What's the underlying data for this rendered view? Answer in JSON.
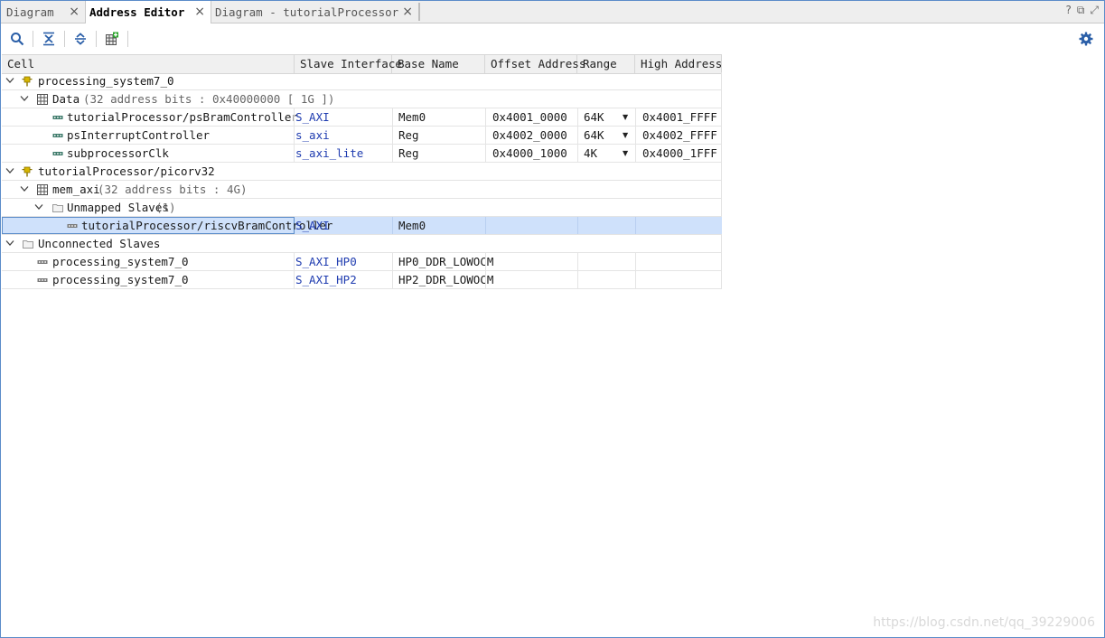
{
  "tabs": [
    {
      "label": "Diagram",
      "close": "×"
    },
    {
      "label": "Address Editor",
      "close": "×"
    },
    {
      "label": "Diagram - tutorialProcessor",
      "close": "×"
    }
  ],
  "window_controls": {
    "help": "?",
    "restore": "⧉",
    "maximize": "⤢"
  },
  "toolbar": {
    "search": "search-icon",
    "collapse_all": "collapse-all-icon",
    "expand_all": "expand-all-icon",
    "auto_assign": "auto-assign-address-icon",
    "settings": "gear-icon"
  },
  "columns": [
    "Cell",
    "Slave Interface",
    "Base Name",
    "Offset Address",
    "Range",
    "High Address"
  ],
  "rows": [
    {
      "cell": "processing_system7_0",
      "note": "",
      "slave": "",
      "base": "",
      "offset": "",
      "range": "",
      "high": ""
    },
    {
      "cell": "Data",
      "note": "(32 address bits : 0x40000000 [ 1G ])",
      "slave": "",
      "base": "",
      "offset": "",
      "range": "",
      "high": ""
    },
    {
      "cell": "tutorialProcessor/psBramController",
      "note": "",
      "slave": "S_AXI",
      "base": "Mem0",
      "offset": "0x4001_0000",
      "range": "64K",
      "high": "0x4001_FFFF"
    },
    {
      "cell": "psInterruptController",
      "note": "",
      "slave": "s_axi",
      "base": "Reg",
      "offset": "0x4002_0000",
      "range": "64K",
      "high": "0x4002_FFFF"
    },
    {
      "cell": "subprocessorClk",
      "note": "",
      "slave": "s_axi_lite",
      "base": "Reg",
      "offset": "0x4000_1000",
      "range": "4K",
      "high": "0x4000_1FFF"
    },
    {
      "cell": "tutorialProcessor/picorv32",
      "note": "",
      "slave": "",
      "base": "",
      "offset": "",
      "range": "",
      "high": ""
    },
    {
      "cell": "mem_axi",
      "note": "(32 address bits : 4G)",
      "slave": "",
      "base": "",
      "offset": "",
      "range": "",
      "high": ""
    },
    {
      "cell": "Unmapped Slaves",
      "note": "(1)",
      "slave": "",
      "base": "",
      "offset": "",
      "range": "",
      "high": ""
    },
    {
      "cell": "tutorialProcessor/riscvBramController",
      "note": "",
      "slave": "S_AXI",
      "base": "Mem0",
      "offset": "",
      "range": "",
      "high": ""
    },
    {
      "cell": "Unconnected Slaves",
      "note": "",
      "slave": "",
      "base": "",
      "offset": "",
      "range": "",
      "high": ""
    },
    {
      "cell": "processing_system7_0",
      "note": "",
      "slave": "S_AXI_HP0",
      "base": "HP0_DDR_LOWOCM",
      "offset": "",
      "range": "",
      "high": ""
    },
    {
      "cell": "processing_system7_0",
      "note": "",
      "slave": "S_AXI_HP2",
      "base": "HP2_DDR_LOWOCM",
      "offset": "",
      "range": "",
      "high": ""
    }
  ],
  "watermark": "https://blog.csdn.net/qq_39229006",
  "colors": {
    "accent": "#5b8cc9",
    "selected_row": "#cfe1fb",
    "link": "#1f3cb0",
    "processor_icon": "#d7b600"
  }
}
